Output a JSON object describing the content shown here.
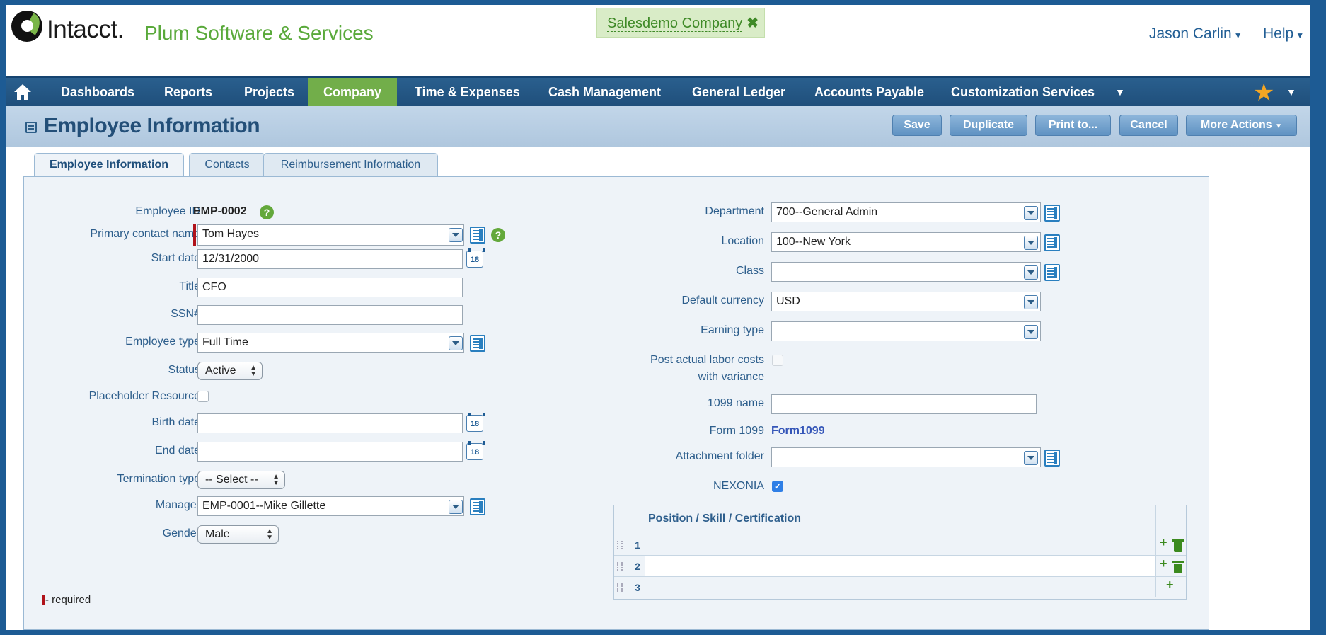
{
  "header": {
    "brand": "Intacct.",
    "tagline": "Plum Software & Services",
    "company": "Salesdemo Company",
    "company_close": "✖",
    "user": "Jason Carlin",
    "help": "Help"
  },
  "nav": {
    "items": [
      "Dashboards",
      "Reports",
      "Projects",
      "Company",
      "Time & Expenses",
      "Cash Management",
      "General Ledger",
      "Accounts Payable",
      "Customization Services"
    ],
    "active": "Company"
  },
  "toolbar": {
    "title": "Employee Information",
    "save": "Save",
    "duplicate": "Duplicate",
    "print": "Print to...",
    "cancel": "Cancel",
    "more_actions": "More Actions"
  },
  "tabs": [
    "Employee Information",
    "Contacts",
    "Reimbursement Information"
  ],
  "form_left": {
    "employee_id_label": "Employee ID",
    "employee_id": "EMP-0002",
    "primary_contact_label": "Primary contact name",
    "primary_contact": "Tom Hayes",
    "start_date_label": "Start date",
    "start_date": "12/31/2000",
    "title_label": "Title",
    "title": "CFO",
    "ssn_label": "SSN#",
    "ssn": "",
    "employee_type_label": "Employee type",
    "employee_type": "Full Time",
    "status_label": "Status",
    "status": "Active",
    "placeholder_label": "Placeholder Resource",
    "placeholder_checked": false,
    "birth_date_label": "Birth date",
    "birth_date": "",
    "end_date_label": "End date",
    "end_date": "",
    "termination_label": "Termination type",
    "termination": "-- Select --",
    "manager_label": "Manager",
    "manager": "EMP-0001--Mike Gillette",
    "gender_label": "Gender",
    "gender": "Male",
    "required_note": "- required",
    "calendar_day": "18"
  },
  "form_right": {
    "department_label": "Department",
    "department": "700--General Admin",
    "location_label": "Location",
    "location": "100--New York",
    "class_label": "Class",
    "class": "",
    "currency_label": "Default currency",
    "currency": "USD",
    "earning_label": "Earning type",
    "earning": "",
    "post_labor_label_1": "Post actual labor costs",
    "post_labor_label_2": "with variance",
    "post_labor_checked": false,
    "name_1099_label": "1099 name",
    "name_1099": "",
    "form_1099_label": "Form 1099",
    "form_1099": "Form1099",
    "attachment_label": "Attachment folder",
    "attachment": "",
    "nexonia_label": "NEXONIA",
    "nexonia_checked": true
  },
  "grid": {
    "header": "Position / Skill / Certification",
    "rows": [
      "1",
      "2",
      "3"
    ]
  },
  "colors": {
    "nav_bg": "#1f4f7b",
    "nav_active": "#72ae4a",
    "brand_green": "#59a93a",
    "label_blue": "#2d5e8c",
    "required": "#b0121a"
  },
  "icons": [
    "home-icon",
    "star-icon",
    "help-icon",
    "lookup-icon",
    "calendar-icon",
    "dropdown-icon",
    "add-icon",
    "trash-icon"
  ]
}
